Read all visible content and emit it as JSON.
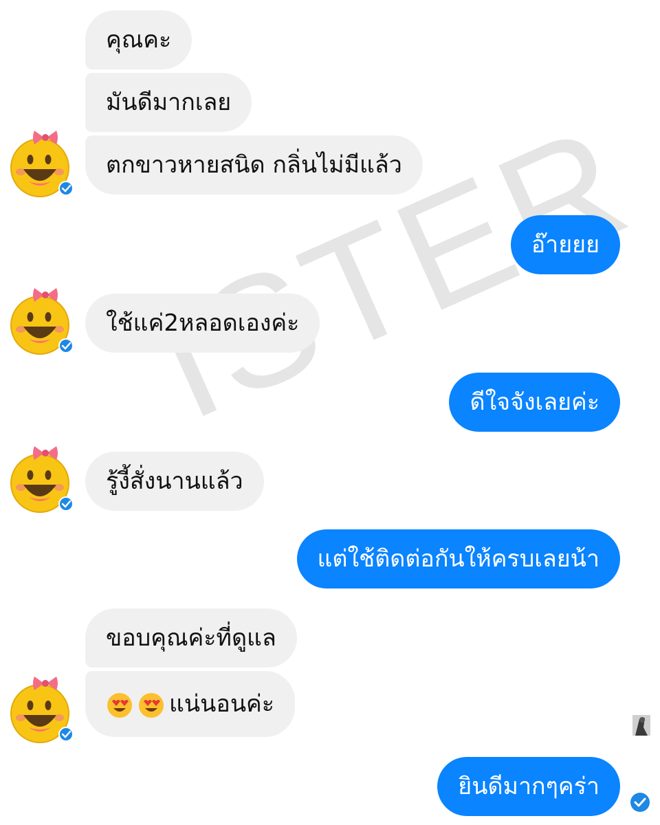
{
  "conversation": {
    "messages": [
      {
        "side": "in",
        "text": "คุณคะ"
      },
      {
        "side": "in",
        "text": "มันดีมากเลย"
      },
      {
        "side": "in",
        "text": "ตกขาวหายสนิด กลิ่นไม่มีแล้ว"
      },
      {
        "side": "out",
        "text": "อ๊ายยย"
      },
      {
        "side": "in",
        "text": "ใช้แค่2หลอดเองค่ะ"
      },
      {
        "side": "out",
        "text": "ดีใจจังเลยค่ะ"
      },
      {
        "side": "in",
        "text": "รู้งี้สั่งนานแล้ว"
      },
      {
        "side": "out",
        "text": "แต่ใช้ติดต่อกันให้ครบเลยน้า"
      },
      {
        "side": "in",
        "text": "ขอบคุณค่ะที่ดูแล"
      },
      {
        "side": "in",
        "text": "แน่นอนค่ะ",
        "leading_emoji": [
          "heart-eyes-emoji",
          "heart-eyes-emoji"
        ]
      },
      {
        "side": "out",
        "text": "ยินดีมากๆคร่า"
      }
    ]
  },
  "watermark": {
    "text": "ISTER"
  },
  "icons": {
    "avatar": "smiling-face-with-bow-avatar",
    "verified": "verified-check-icon",
    "read_receipt": "seen-avatar-thumbnail",
    "delivered": "delivered-check-icon"
  },
  "colors": {
    "outgoing_bubble": "#0a84ff",
    "incoming_bubble": "#f0f0f0",
    "background": "#ffffff"
  }
}
